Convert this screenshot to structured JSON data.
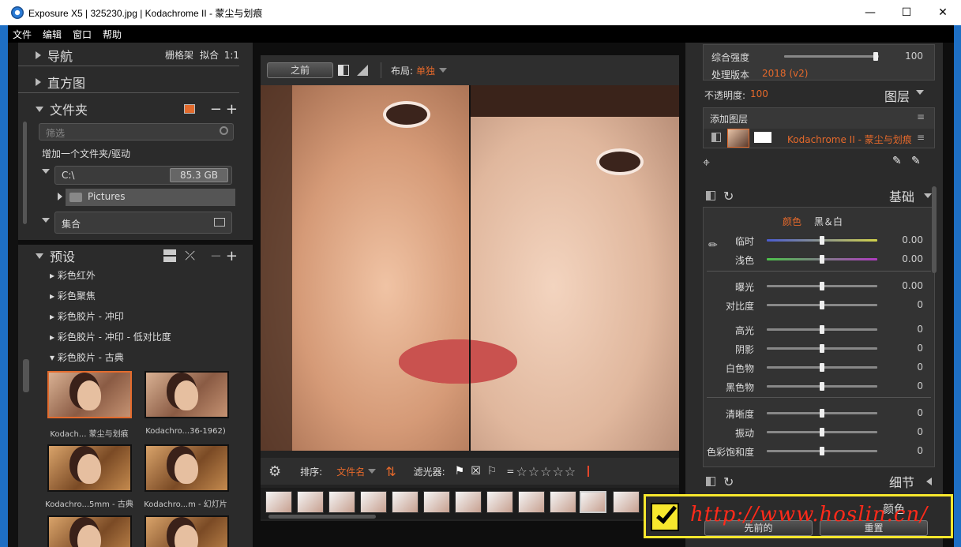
{
  "window": {
    "title": "Exposure X5 | 325230.jpg |  Kodachrome II - 蒙尘与划痕"
  },
  "menu": [
    "文件",
    "编辑",
    "窗口",
    "帮助"
  ],
  "left": {
    "nav": {
      "label": "导航",
      "opts": [
        "栅格架",
        "拟合",
        "1:1"
      ]
    },
    "histogram": "直方图",
    "folders": {
      "label": "文件夹",
      "filter_placeholder": "筛选",
      "add": "增加一个文件夹/驱动",
      "drive": "C:\\",
      "drive_size": "85.3 GB",
      "pictures": "Pictures",
      "collection": "集合"
    },
    "presets": {
      "label": "预设",
      "items": [
        "彩色红外",
        "彩色聚焦",
        "彩色胶片 - 冲印",
        "彩色胶片 - 冲印 - 低对比度",
        "彩色胶片 - 古典"
      ],
      "thumbs": [
        "Kodach... 蒙尘与划痕",
        "Kodachro...36-1962)",
        "Kodachro...5mm - 古典",
        "Kodachro...m - 幻灯片"
      ]
    }
  },
  "center": {
    "before": "之前",
    "layout_label": "布局:",
    "layout_value": "单独",
    "sort_label": "排序:",
    "sort_value": "文件名",
    "filter_label": "滤光器:",
    "eq": "="
  },
  "right": {
    "overall_label": "综合强度",
    "overall_value": "100",
    "version_label": "处理版本",
    "version_value": "2018 (v2)",
    "opacity_label": "不透明度:",
    "opacity_value": "100",
    "layers": "图层",
    "add_layer": "添加图层",
    "layer_name": "Kodachrome II - 蒙尘与划痕",
    "basic": "基础",
    "color": "颜色",
    "bw": "黑＆白",
    "sliders": [
      {
        "label": "临时",
        "value": "0.00"
      },
      {
        "label": "浅色",
        "value": "0.00"
      },
      {
        "label": "曝光",
        "value": "0.00"
      },
      {
        "label": "对比度",
        "value": "0"
      },
      {
        "label": "高光",
        "value": "0"
      },
      {
        "label": "阴影",
        "value": "0"
      },
      {
        "label": "白色物",
        "value": "0"
      },
      {
        "label": "黑色物",
        "value": "0"
      },
      {
        "label": "清晰度",
        "value": "0"
      },
      {
        "label": "振动",
        "value": "0"
      },
      {
        "label": "色彩饱和度",
        "value": "0"
      }
    ],
    "detail": "细节",
    "color_section": "颜色"
  },
  "bottom": {
    "prev": "先前的",
    "reset": "重置"
  },
  "watermark": "http://www.hoslin.cn/"
}
